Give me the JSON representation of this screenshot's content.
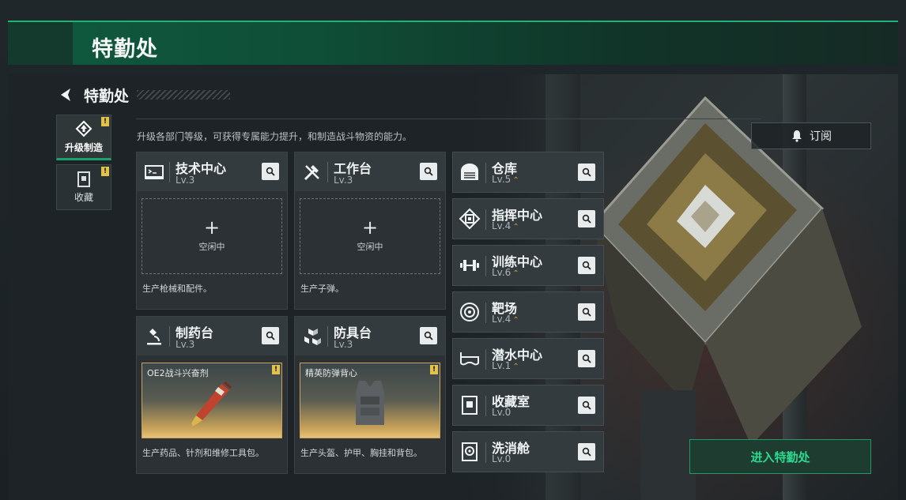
{
  "window": {
    "title": "特勤处"
  },
  "nav": {
    "title": "特勤处"
  },
  "side_tabs": [
    {
      "label": "升级制造",
      "badge": "!",
      "icon": "upgrade-gear-icon",
      "active": true
    },
    {
      "label": "收藏",
      "badge": "!",
      "icon": "collection-cabinet-icon",
      "active": false
    }
  ],
  "description": "升级各部门等级，可获得专属能力提升，和制造战斗物资的能力。",
  "subscribe": {
    "label": "订阅",
    "icon": "bell-icon"
  },
  "production_departments": [
    {
      "name": "技术中心",
      "level": "Lv.3",
      "icon": "computer-terminal-icon",
      "slot_state": "空闲中",
      "description": "生产枪械和配件。"
    },
    {
      "name": "工作台",
      "level": "Lv.3",
      "icon": "tools-icon",
      "slot_state": "空闲中",
      "description": "生产子弹。"
    },
    {
      "name": "制药台",
      "level": "Lv.3",
      "icon": "microscope-icon",
      "item_name": "OE2战斗兴奋剂",
      "item_badge": "!",
      "description": "生产药品、针剂和维修工具包。"
    },
    {
      "name": "防具台",
      "level": "Lv.3",
      "icon": "armor-blocks-icon",
      "item_name": "精英防弹背心",
      "item_badge": "!",
      "description": "生产头盔、护甲、胸挂和背包。"
    }
  ],
  "facilities": [
    {
      "name": "仓库",
      "level": "Lv.5",
      "icon": "warehouse-icon"
    },
    {
      "name": "指挥中心",
      "level": "Lv.4",
      "icon": "command-chip-icon"
    },
    {
      "name": "训练中心",
      "level": "Lv.6",
      "icon": "dumbbell-icon"
    },
    {
      "name": "靶场",
      "level": "Lv.4",
      "icon": "target-icon"
    },
    {
      "name": "潜水中心",
      "level": "Lv.1",
      "icon": "diving-mask-icon"
    },
    {
      "name": "收藏室",
      "level": "Lv.0",
      "icon": "collection-room-icon"
    },
    {
      "name": "洗消舱",
      "level": "Lv.0",
      "icon": "decontamination-icon"
    }
  ],
  "level_up_glyph": "⌃",
  "enter_button": {
    "label": "进入特勤处"
  },
  "colors": {
    "accent_green": "#1fb37a",
    "badge_yellow": "#e2c24a",
    "enter_text": "#2bd98f"
  }
}
